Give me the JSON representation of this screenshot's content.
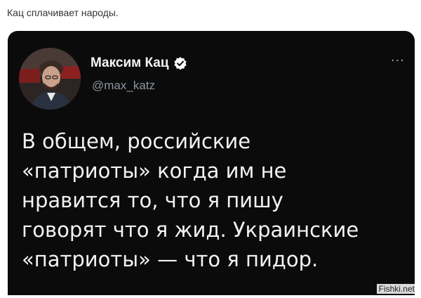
{
  "post": {
    "caption": "Кац сплачивает народы."
  },
  "tweet": {
    "author_name": "Максим Кац",
    "handle": "@max_katz",
    "more_label": "···",
    "text_lines": [
      "В общем, российские",
      "«патриоты» когда им не",
      "нравится то, что я пишу",
      "говорят что я жид. Украинские",
      "«патриоты» — что я пидор."
    ]
  },
  "watermark": {
    "text": "Fishki.net"
  },
  "icons": {
    "verified": "verified-badge-icon",
    "more": "more-options-icon"
  },
  "colors": {
    "card_bg": "#0b0b0c",
    "text": "#f2f2f2",
    "handle": "#8b949c",
    "verified": "#ffffff"
  }
}
